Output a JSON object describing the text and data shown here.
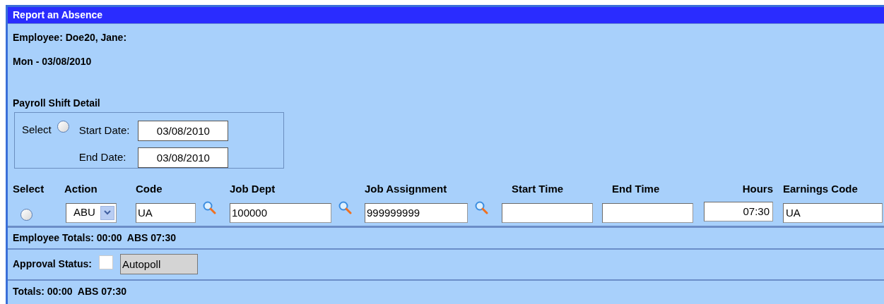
{
  "window": {
    "title": "Report an Absence"
  },
  "employee": "Employee: Doe20, Jane:",
  "date": "Mon - 03/08/2010",
  "shift_detail": {
    "title": "Payroll Shift Detail",
    "select_label": "Select",
    "selected": false,
    "start_label": "Start Date:",
    "start_value": "03/08/2010",
    "end_label": "End Date:",
    "end_value": "03/08/2010"
  },
  "columns": [
    "Select",
    "Action",
    "Code",
    "Job Dept",
    "Job Assignment",
    "Start Time",
    "End Time",
    "Hours",
    "Earnings Code"
  ],
  "row": [
    {
      "kind": "radio",
      "selected": false
    },
    {
      "kind": "dropdown",
      "value": "ABU"
    },
    {
      "kind": "lookup",
      "value": "UA"
    },
    {
      "kind": "lookup",
      "value": "100000"
    },
    {
      "kind": "lookup",
      "value": "999999999"
    },
    {
      "kind": "text"
    },
    {
      "kind": "text"
    },
    {
      "kind": "number",
      "value": "07:30"
    },
    {
      "kind": "text",
      "value": "UA"
    }
  ],
  "employee_totals": "Employee Totals: 00:00  ABS 07:30",
  "approval": {
    "label": "Approval Status:",
    "checked": false,
    "value": "Autopoll"
  },
  "totals": "Totals: 00:00  ABS 07:30"
}
